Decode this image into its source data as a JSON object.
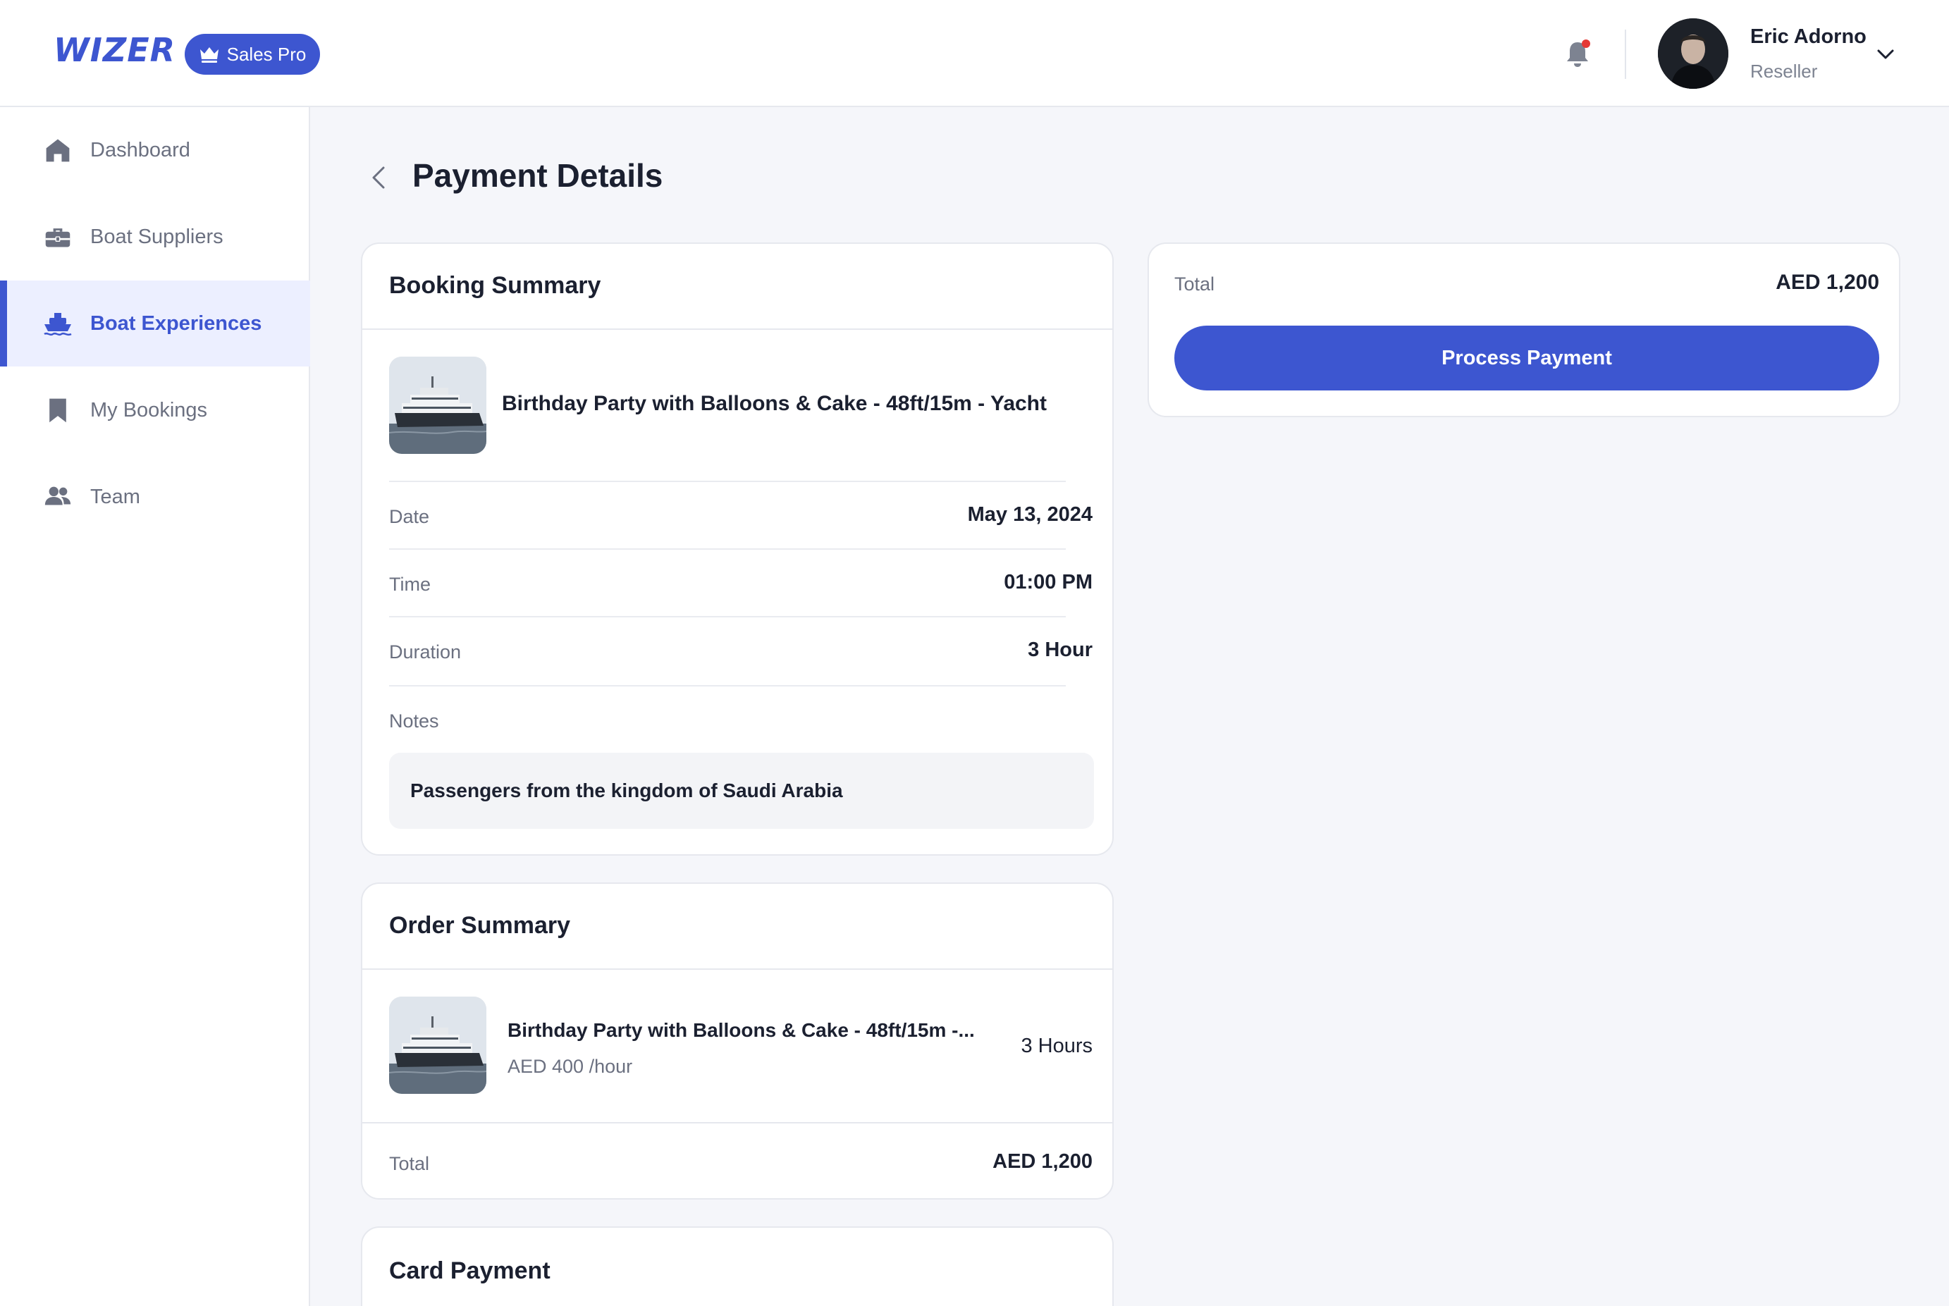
{
  "header": {
    "logo": "WIZER",
    "badge_label": "Sales Pro",
    "user": {
      "name": "Eric Adorno",
      "role": "Reseller"
    }
  },
  "sidebar": {
    "items": [
      {
        "label": "Dashboard",
        "icon": "home-icon",
        "active": false
      },
      {
        "label": "Boat Suppliers",
        "icon": "briefcase-icon",
        "active": false
      },
      {
        "label": "Boat Experiences",
        "icon": "ship-icon",
        "active": true
      },
      {
        "label": "My Bookings",
        "icon": "bookmark-icon",
        "active": false
      },
      {
        "label": "Team",
        "icon": "users-icon",
        "active": false
      }
    ]
  },
  "page": {
    "title": "Payment Details"
  },
  "booking_summary": {
    "title": "Booking Summary",
    "experience_name": "Birthday Party with Balloons & Cake - 48ft/15m - Yacht",
    "rows": [
      {
        "label": "Date",
        "value": "May 13, 2024"
      },
      {
        "label": "Time",
        "value": "01:00 PM"
      },
      {
        "label": "Duration",
        "value": "3 Hour"
      }
    ],
    "notes_label": "Notes",
    "notes_text": "Passengers from the kingdom of Saudi Arabia"
  },
  "order_summary": {
    "title": "Order Summary",
    "item_name": "Birthday Party with Balloons & Cake - 48ft/15m -...",
    "item_price": "AED 400 /hour",
    "item_quantity": "3 Hours",
    "total_label": "Total",
    "total_value": "AED 1,200"
  },
  "card_payment": {
    "title": "Card Payment"
  },
  "payment_panel": {
    "total_label": "Total",
    "total_value": "AED 1,200",
    "button_label": "Process Payment"
  },
  "colors": {
    "accent": "#3d56d0",
    "notification_dot": "#e53935",
    "background": "#f5f6fa"
  }
}
